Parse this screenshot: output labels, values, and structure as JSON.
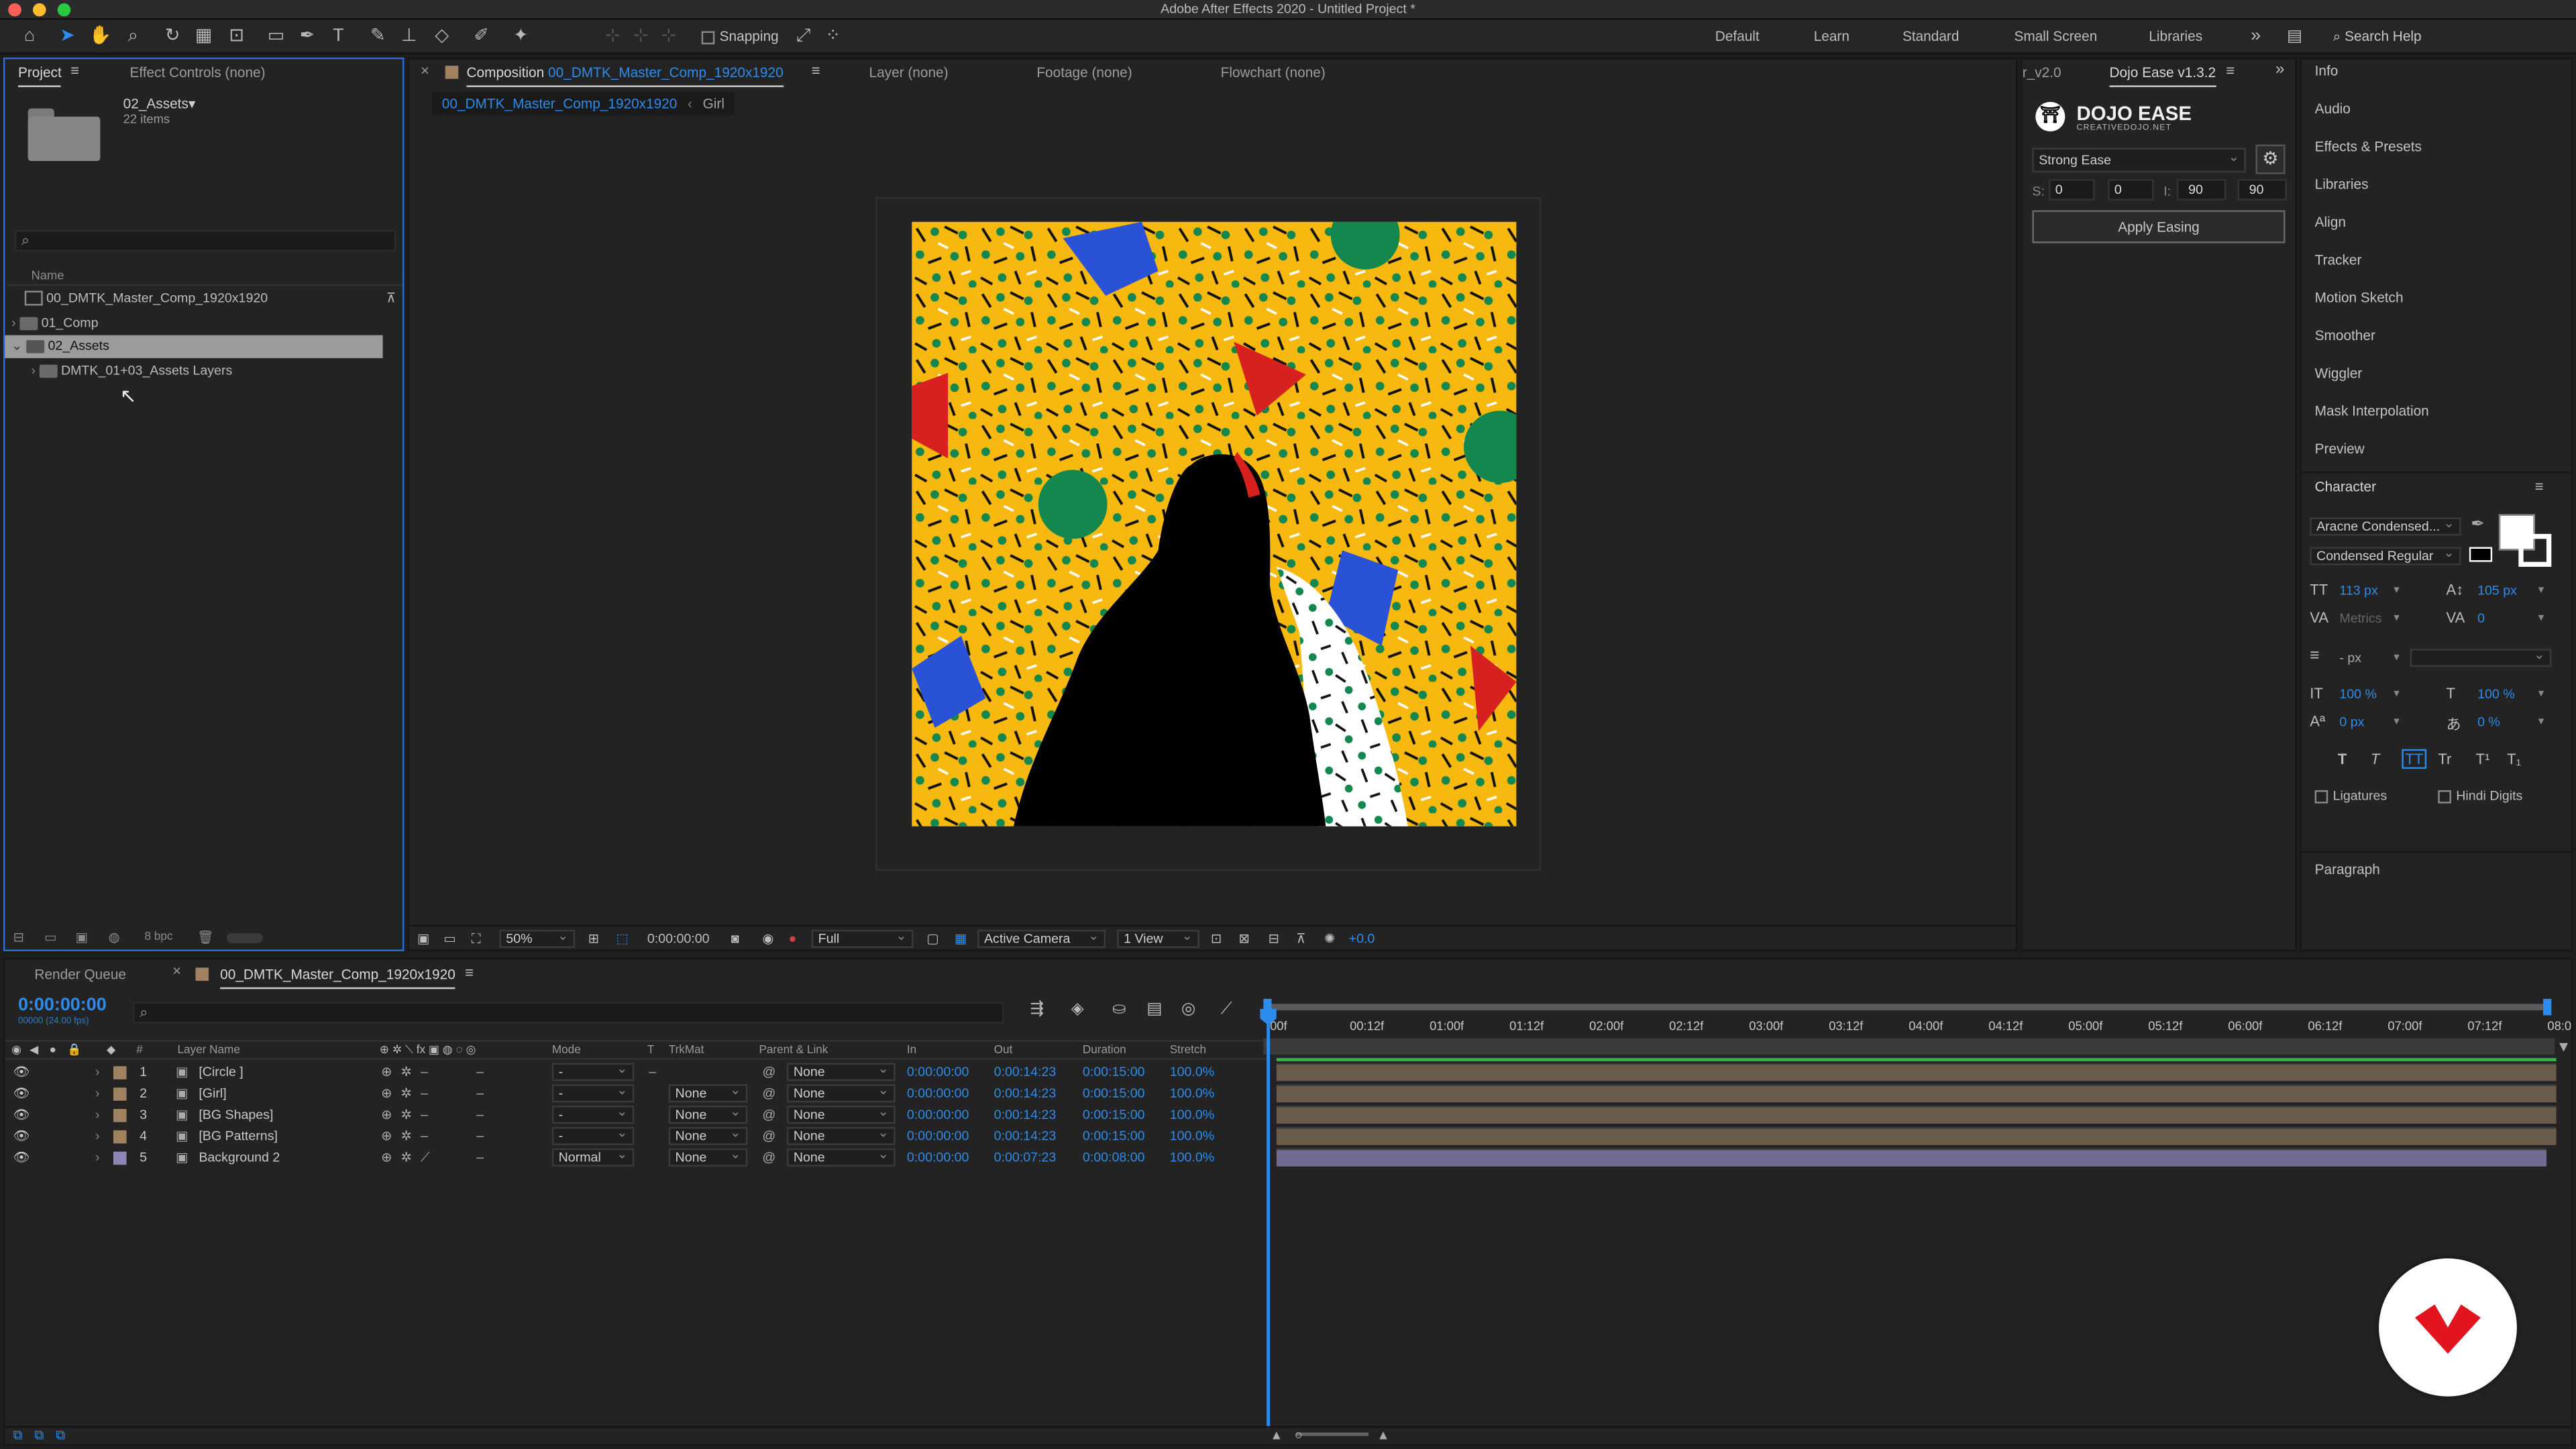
{
  "app": {
    "title": "Adobe After Effects 2020 - Untitled Project *"
  },
  "toolbar": {
    "snapping_label": "Snapping",
    "workspaces": [
      "Default",
      "Learn",
      "Standard",
      "Small Screen",
      "Libraries"
    ],
    "search_placeholder": "Search Help"
  },
  "project_panel": {
    "tabs": [
      "Project",
      "Effect Controls (none)"
    ],
    "selected_name": "02_Assets▾",
    "selected_count": "22 items",
    "col_name": "Name",
    "items": [
      "00_DMTK_Master_Comp_1920x1920",
      "01_Comp",
      "02_Assets",
      "DMTK_01+03_Assets Layers"
    ],
    "bpc": "8 bpc"
  },
  "comp_panel": {
    "tabs": [
      "Composition",
      "Layer (none)",
      "Footage (none)",
      "Flowchart (none)"
    ],
    "comp_name": "00_DMTK_Master_Comp_1920x1920",
    "breadcrumb": [
      "00_DMTK_Master_Comp_1920x1920",
      "Girl"
    ],
    "zoom": "50%",
    "time": "0:00:00:00",
    "resolution": "Full",
    "camera": "Active Camera",
    "views": "1 View",
    "exposure": "+0.0"
  },
  "dojo": {
    "tabs": [
      "r_v2.0",
      "Dojo Ease v1.3.2"
    ],
    "brand": "DOJO EASE",
    "brand_sub": "CREATIVEDOJO.NET",
    "preset": "Strong Ease",
    "s_label": "S:",
    "i_label": "I:",
    "s_values": [
      "0",
      "0"
    ],
    "i_values": [
      "90",
      "90"
    ],
    "apply": "Apply Easing"
  },
  "sidebar": {
    "items": [
      "Info",
      "Audio",
      "Effects & Presets",
      "Libraries",
      "Align",
      "Tracker",
      "Motion Sketch",
      "Smoother",
      "Wiggler",
      "Mask Interpolation",
      "Preview"
    ],
    "character_title": "Character",
    "font": "Aracne Condensed...",
    "style": "Condensed Regular",
    "font_size": "113 px",
    "leading": "105 px",
    "kerning": "Metrics",
    "tracking": "0",
    "stroke_width": "- px",
    "vscale": "100 %",
    "hscale": "100 %",
    "baseline": "0 px",
    "tsume": "0 %",
    "style_buttons": [
      "T",
      "T",
      "TT",
      "Tr",
      "T¹",
      "T₁"
    ],
    "ligatures": "Ligatures",
    "hindi": "Hindi Digits",
    "paragraph": "Paragraph"
  },
  "timeline": {
    "tabs": [
      "Render Queue",
      "00_DMTK_Master_Comp_1920x1920"
    ],
    "timecode": "0:00:00:00",
    "timecode_sub": "00000 (24.00 fps)",
    "headers": [
      "#",
      "Layer Name",
      "Mode",
      "T",
      "TrkMat",
      "Parent & Link",
      "In",
      "Out",
      "Duration",
      "Stretch"
    ],
    "layers": [
      {
        "num": "1",
        "name": "[Circle ]",
        "mode": "-",
        "trkmat": "",
        "parent": "None",
        "in": "0:00:00:00",
        "out": "0:00:14:23",
        "dur": "0:00:15:00",
        "stretch": "100.0%",
        "color": "#a08160"
      },
      {
        "num": "2",
        "name": "[Girl]",
        "mode": "-",
        "trkmat": "None",
        "parent": "None",
        "in": "0:00:00:00",
        "out": "0:00:14:23",
        "dur": "0:00:15:00",
        "stretch": "100.0%",
        "color": "#a08160"
      },
      {
        "num": "3",
        "name": "[BG Shapes]",
        "mode": "-",
        "trkmat": "None",
        "parent": "None",
        "in": "0:00:00:00",
        "out": "0:00:14:23",
        "dur": "0:00:15:00",
        "stretch": "100.0%",
        "color": "#a08160"
      },
      {
        "num": "4",
        "name": "[BG Patterns]",
        "mode": "-",
        "trkmat": "None",
        "parent": "None",
        "in": "0:00:00:00",
        "out": "0:00:14:23",
        "dur": "0:00:15:00",
        "stretch": "100.0%",
        "color": "#a08160"
      },
      {
        "num": "5",
        "name": "Background 2",
        "mode": "Normal",
        "trkmat": "None",
        "parent": "None",
        "in": "0:00:00:00",
        "out": "0:00:07:23",
        "dur": "0:00:08:00",
        "stretch": "100.0%",
        "color": "#8c87b5"
      }
    ],
    "ruler": [
      "00f",
      "00:12f",
      "01:00f",
      "01:12f",
      "02:00f",
      "02:12f",
      "03:00f",
      "03:12f",
      "04:00f",
      "04:12f",
      "05:00f",
      "05:12f",
      "06:00f",
      "06:12f",
      "07:00f",
      "07:12f",
      "08:0"
    ]
  },
  "colors": {
    "accent": "#2d8ceb",
    "canvas_yellow": "#f7b80f",
    "green": "#14874e",
    "blue": "#2a52d6",
    "red": "#d6211f",
    "logo_red": "#e2141d"
  }
}
